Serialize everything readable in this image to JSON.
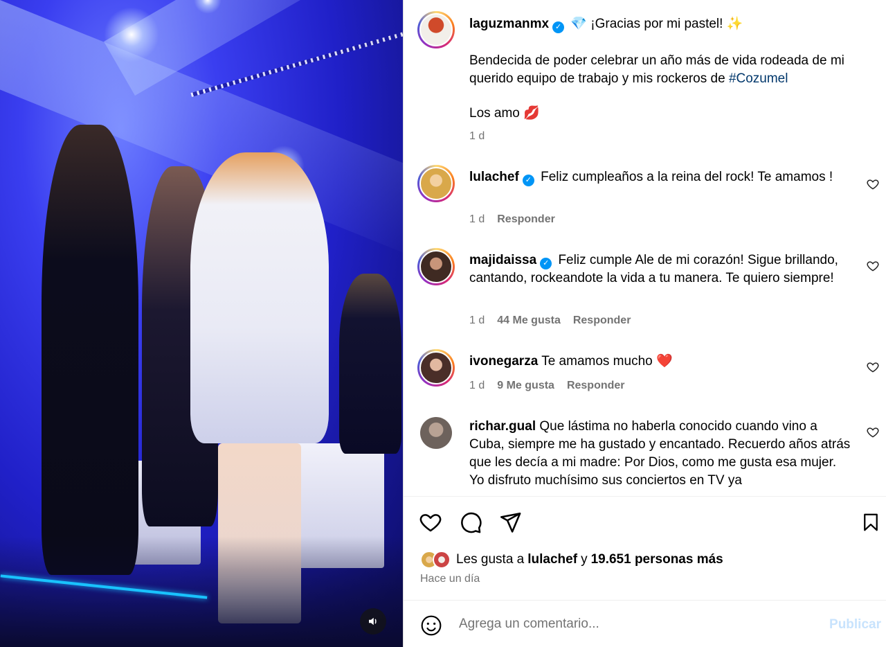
{
  "post": {
    "author": "laguzmanmx",
    "caption_line1": "💎 ¡Gracias por mi pastel! ✨",
    "caption_line2_part1": "Bendecida de poder celebrar un año más de vida rodeada de mi querido equipo de trabajo y mis rockeros de",
    "caption_hashtag": "#Cozumel",
    "caption_line3": "Los amo 💋",
    "age": "1 d"
  },
  "comments": [
    {
      "user": "lulachef",
      "verified": true,
      "text": "Feliz cumpleaños a la reina del rock! Te amamos !",
      "age": "1 d",
      "likes": "",
      "reply": "Responder",
      "avatar_color": "#d9a84a"
    },
    {
      "user": "majidaissa",
      "verified": true,
      "text": "Feliz cumple Ale de mi corazón! Sigue brillando, cantando, rockeandote la vida a tu manera. Te quiero siempre!",
      "age": "1 d",
      "likes": "44 Me gusta",
      "reply": "Responder",
      "avatar_color": "#7a5a48"
    },
    {
      "user": "ivonegarza",
      "verified": false,
      "text": "Te amamos mucho ❤️",
      "age": "1 d",
      "likes": "9 Me gusta",
      "reply": "Responder",
      "avatar_color": "#5b3a34"
    },
    {
      "user": "richar.gual",
      "verified": false,
      "text": "Que lástima no haberla conocido cuando vino a Cuba, siempre me ha gustado y encantado. Recuerdo años atrás que les decía a mi madre: Por Dios, como me gusta esa mujer. Yo disfruto muchísimo sus conciertos en TV ya",
      "age": "",
      "likes": "",
      "reply": "",
      "avatar_color": "#8a7a70"
    }
  ],
  "likes": {
    "prefix": "Les gusta a",
    "first_user": "lulachef",
    "conj": "y",
    "others": "19.651 personas más"
  },
  "timestamp": "Hace un día",
  "composer": {
    "placeholder": "Agrega un comentario...",
    "publish_label": "Publicar"
  },
  "colors": {
    "accent": "#0095f6",
    "publish_disabled": "#c8e3fd",
    "hashtag": "#00376b",
    "secondary_text": "#737373"
  },
  "icons": [
    "sound-icon",
    "verified-icon",
    "heart-icon",
    "comment-icon",
    "share-icon",
    "bookmark-icon",
    "emoji-icon"
  ]
}
